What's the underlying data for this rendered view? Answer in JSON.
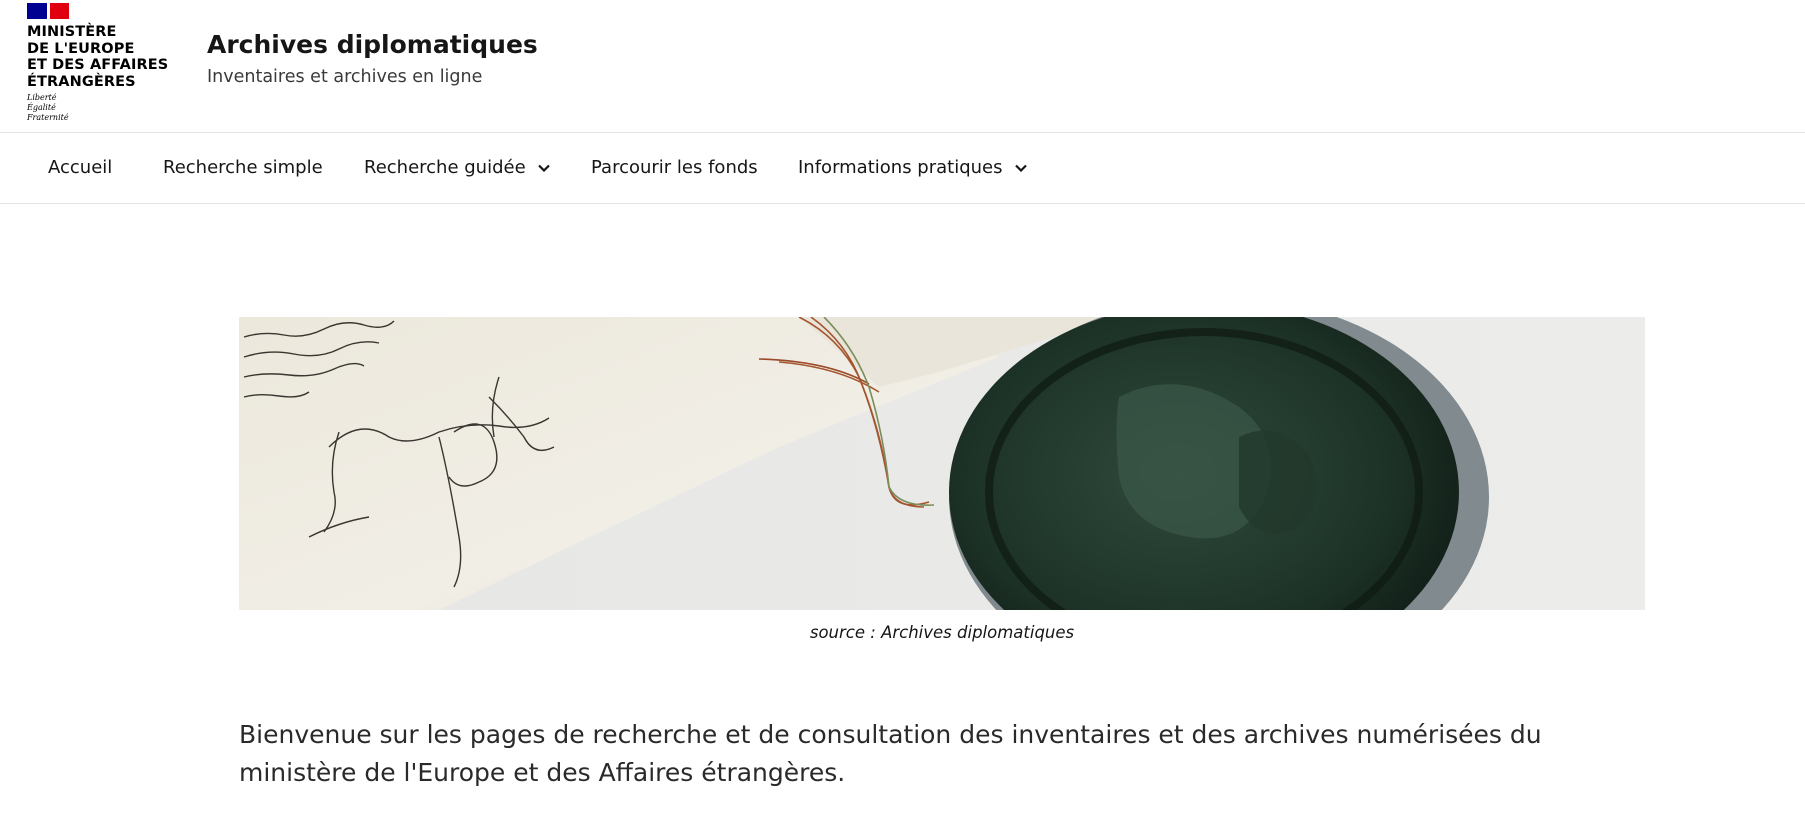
{
  "header": {
    "ministry_lines": [
      "MINISTÈRE",
      "DE L'EUROPE",
      "ET DES AFFAIRES",
      "ÉTRANGÈRES"
    ],
    "motto_lines": [
      "Liberté",
      "Égalité",
      "Fraternité"
    ],
    "site_title": "Archives diplomatiques",
    "site_tagline": "Inventaires et archives en ligne"
  },
  "nav": {
    "items": [
      {
        "label": "Accueil"
      },
      {
        "label": "Recherche simple"
      },
      {
        "label": "Recherche guidée"
      },
      {
        "label": "Parcourir les fonds"
      },
      {
        "label": "Informations pratiques"
      }
    ]
  },
  "banner": {
    "caption": "source : Archives diplomatiques"
  },
  "main": {
    "welcome_text": "Bienvenue sur les pages de recherche et de consultation des inventaires et des archives numérisées du ministère de l'Europe et des Affaires étrangères."
  },
  "colors": {
    "flag_blue": "#000091",
    "flag_red": "#e1000f",
    "text": "#161616"
  }
}
